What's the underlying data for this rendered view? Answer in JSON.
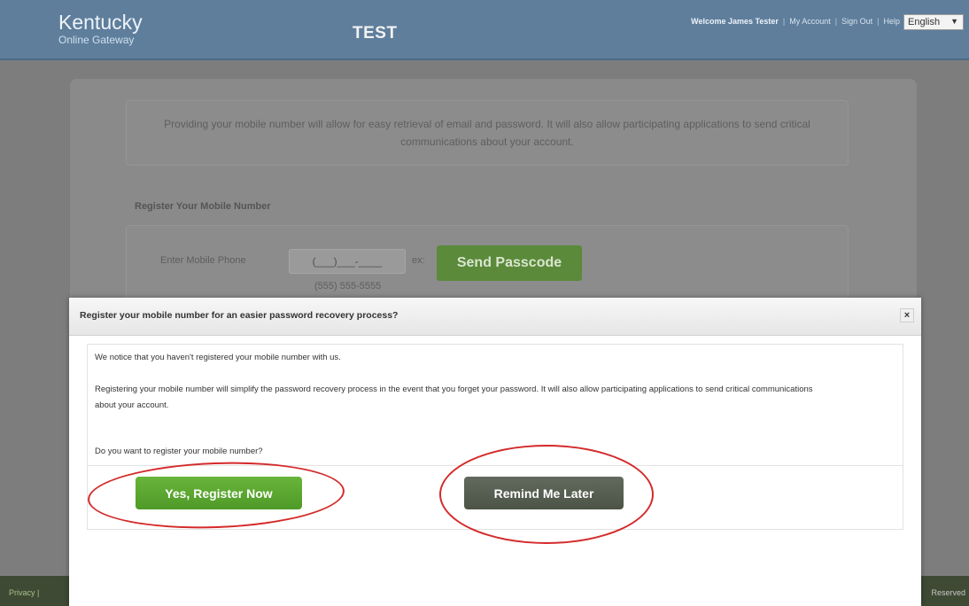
{
  "header": {
    "brand_name": "Kentucky",
    "brand_sub": "Online Gateway",
    "env_label": "TEST",
    "welcome": "Welcome James Tester",
    "links": [
      "My Account",
      "Sign Out",
      "Help"
    ],
    "language": "English"
  },
  "background_page": {
    "info_text": "Providing your mobile number will allow for easy retrieval of email and password. It will also allow participating applications to send critical communications about your account.",
    "section_title": "Register Your Mobile Number",
    "phone_label": "Enter Mobile Phone",
    "phone_value": "(___)___-____",
    "ex_label": "ex:",
    "example_number": "(555) 555-5555",
    "send_button": "Send Passcode"
  },
  "footer": {
    "left": "Privacy |",
    "right": "Reserved"
  },
  "modal": {
    "title": "Register your mobile number for an easier password recovery process?",
    "close_symbol": "×",
    "text1": "We notice that you haven't registered your mobile number with us.",
    "text2": "Registering your mobile number will simplify the password recovery process in the event that you forget your password. It will also allow participating applications to send critical communications about your account.",
    "text3": "Do you want to register your mobile number?",
    "yes_button": "Yes, Register Now",
    "later_button": "Remind Me Later"
  },
  "colors": {
    "header": "#5e7e9c",
    "yes_button": "#5aa630",
    "later_button": "#555d51",
    "annotation": "#d42a2a"
  }
}
